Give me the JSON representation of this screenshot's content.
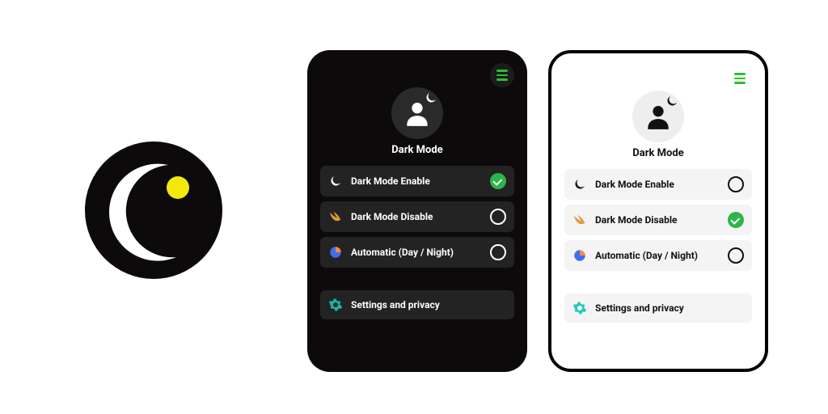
{
  "section_title": "Dark Mode",
  "options": {
    "enable": {
      "label": "Dark Mode Enable"
    },
    "disable": {
      "label": "Dark Mode Disable"
    },
    "automatic": {
      "label": "Automatic (Day / Night)"
    }
  },
  "settings_label": "Settings and privacy",
  "colors": {
    "accent_green": "#2cb54a",
    "swift_orange": "#e09a3a",
    "auto_blue": "#3d6df0",
    "gear_teal": "#16b7a7",
    "logo_yellow": "#f2e90a"
  },
  "dark_panel": {
    "selected": "enable"
  },
  "light_panel": {
    "selected": "disable"
  }
}
